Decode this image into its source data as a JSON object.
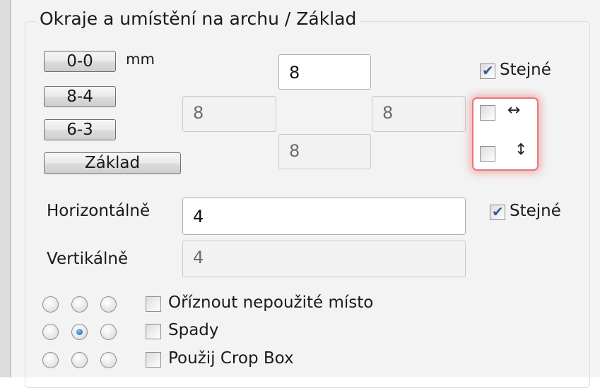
{
  "group_title": "Okraje a umístění na archu / Základ",
  "unit_label": "mm",
  "presets": [
    "0-0",
    "8-4",
    "6-3",
    "Základ"
  ],
  "margins": {
    "top": "8",
    "left": "8",
    "right": "8",
    "bottom": "8"
  },
  "same_label": "Stejné",
  "same_checked": true,
  "mirror_horizontal_icon": "↔",
  "mirror_vertical_icon": "↕",
  "mirror_horizontal_icon_name": "horizontal-arrows-icon",
  "mirror_vertical_icon_name": "vertical-arrows-icon",
  "spacing": {
    "horizontal_label": "Horizontálně",
    "horizontal_value": "4",
    "vertical_label": "Vertikálně",
    "vertical_value": "4",
    "same_label": "Stejné",
    "same_checked": true
  },
  "position_grid_selected": "middle-center",
  "options": [
    {
      "label": "Oříznout nepoužité místo",
      "checked": false
    },
    {
      "label": "Spady",
      "checked": false
    },
    {
      "label": "Použij Crop Box",
      "checked": false
    }
  ],
  "colors": {
    "highlight": "#e87777",
    "checkmark": "#3c5a9a",
    "radio_selected": "#1a57a8"
  }
}
